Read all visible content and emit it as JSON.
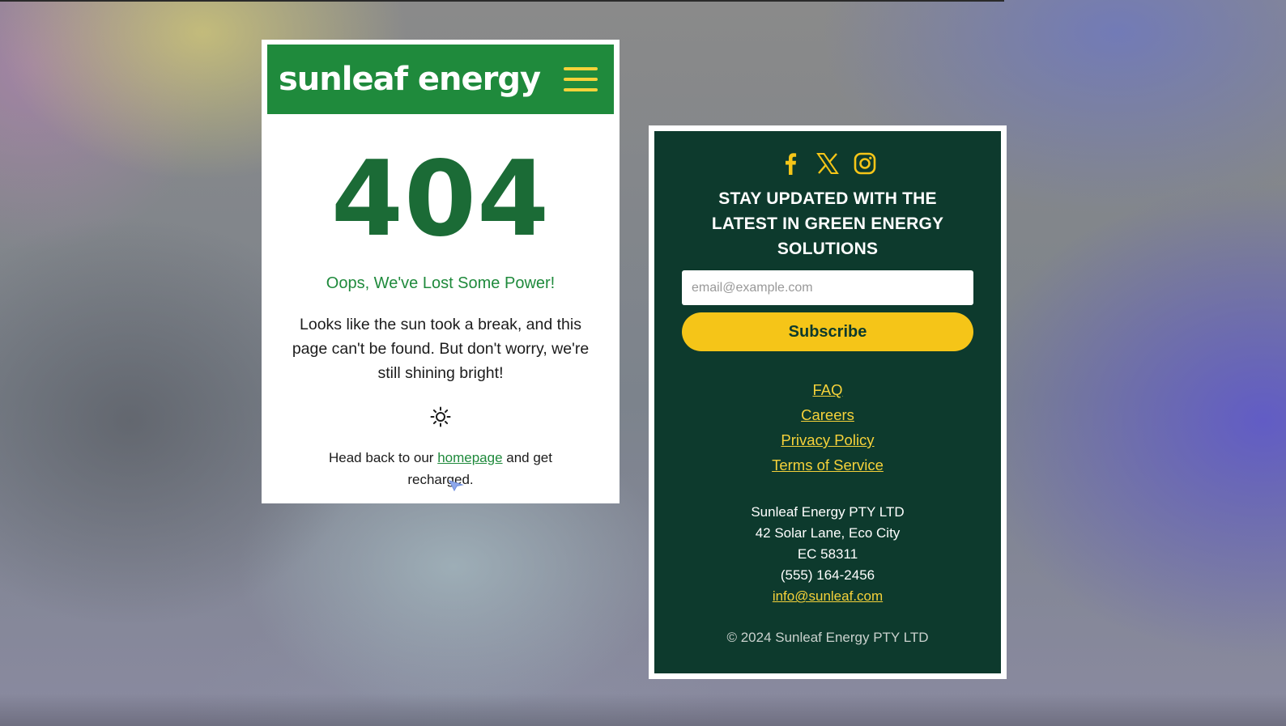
{
  "app": {
    "brand_name": "sunleaf energy",
    "colors": {
      "brand_green": "#1f8a3c",
      "dark_green": "#0d3a2d",
      "accent_yellow": "#f5c518"
    }
  },
  "error_page": {
    "code": "404",
    "heading": "Oops, We've Lost Some Power!",
    "message": "Looks like the sun took a break, and this page can't be found. But don't worry, we're still shining bright!",
    "icon": "sun-icon",
    "back_text_before": "Head back to our ",
    "homepage_link": "homepage",
    "back_text_after": " and get recharged."
  },
  "footer": {
    "social_icons": [
      "facebook-icon",
      "x-icon",
      "instagram-icon"
    ],
    "newsletter_heading": "STAY UPDATED WITH THE LATEST IN GREEN ENERGY SOLUTIONS",
    "email_placeholder": "email@example.com",
    "subscribe_label": "Subscribe",
    "links": [
      "FAQ",
      "Careers",
      "Privacy Policy",
      "Terms of Service"
    ],
    "company": {
      "name": "Sunleaf Energy PTY LTD",
      "address_line1": "42 Solar Lane, Eco City",
      "address_line2": "EC 58311",
      "phone": "(555) 164-2456",
      "email": "info@sunleaf.com"
    },
    "copyright": "© 2024 Sunleaf Energy PTY LTD"
  }
}
